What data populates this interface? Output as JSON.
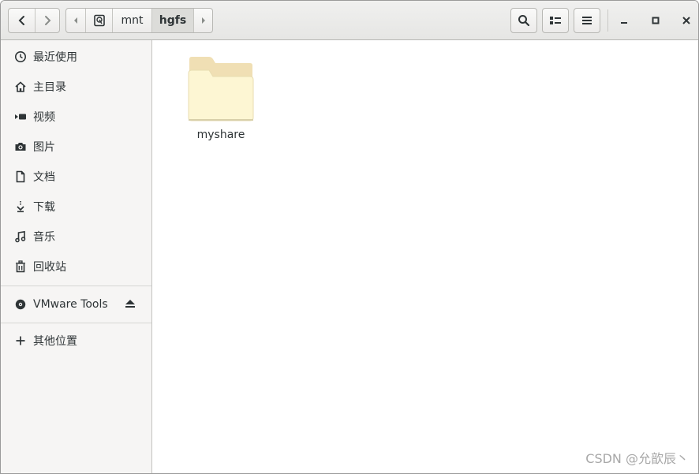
{
  "header": {
    "back_icon": "chevron-left-icon",
    "forward_icon": "chevron-right-icon",
    "path": {
      "scroll_left_icon": "triangle-left-icon",
      "root_icon": "drive-icon",
      "segments": [
        "mnt",
        "hgfs"
      ],
      "scroll_right_icon": "triangle-right-icon"
    },
    "search_icon": "search-icon",
    "view_icon": "list-view-icon",
    "menu_icon": "hamburger-menu-icon",
    "minimize_icon": "minimize-icon",
    "maximize_icon": "maximize-icon",
    "close_icon": "close-icon"
  },
  "sidebar": {
    "places": [
      {
        "label": "最近使用",
        "icon": "clock-icon"
      },
      {
        "label": "主目录",
        "icon": "home-icon"
      },
      {
        "label": "视频",
        "icon": "video-icon"
      },
      {
        "label": "图片",
        "icon": "camera-icon"
      },
      {
        "label": "文档",
        "icon": "document-icon"
      },
      {
        "label": "下载",
        "icon": "download-icon"
      },
      {
        "label": "音乐",
        "icon": "music-icon"
      },
      {
        "label": "回收站",
        "icon": "trash-icon"
      }
    ],
    "devices": [
      {
        "label": "VMware Tools",
        "icon": "disc-icon",
        "eject_icon": "eject-icon"
      }
    ],
    "other": {
      "label": "其他位置",
      "icon": "plus-icon"
    }
  },
  "main": {
    "files": [
      {
        "name": "myshare",
        "icon": "folder-icon"
      }
    ]
  },
  "watermark": "CSDN @允歆辰丶",
  "colors": {
    "folder_front": "#fdf6d3",
    "folder_back": "#f0dfb4",
    "sidebar_bg": "#f6f5f4",
    "header_bg": "#e8e8e7"
  }
}
